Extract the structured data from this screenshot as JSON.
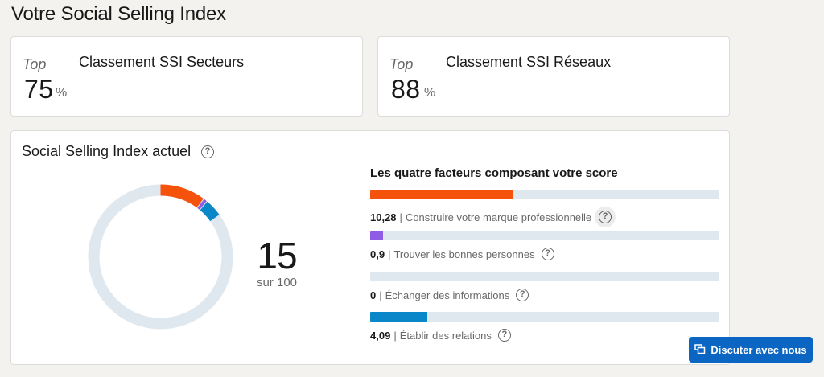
{
  "page_title": "Votre Social Selling Index",
  "rank_cards": [
    {
      "top_label": "Top",
      "title": "Classement SSI Secteurs",
      "value": "75",
      "unit": "%"
    },
    {
      "top_label": "Top",
      "title": "Classement SSI Réseaux",
      "value": "88",
      "unit": "%"
    }
  ],
  "ssi": {
    "title": "Social Selling Index actuel",
    "score": "15",
    "score_max": "sur 100",
    "score_value": 15.27,
    "score_total": 100,
    "factors_title": "Les quatre facteurs composant votre score",
    "factors": [
      {
        "value": "10,28",
        "label": "Construire votre marque professionnelle",
        "amount": 10.28,
        "max": 25,
        "color": "#f5520c"
      },
      {
        "value": "0,9",
        "label": "Trouver les bonnes personnes",
        "amount": 0.9,
        "max": 25,
        "color": "#8f5ce6"
      },
      {
        "value": "0",
        "label": "Échanger des informations",
        "amount": 0,
        "max": 25,
        "color": "#0a66c2"
      },
      {
        "value": "4,09",
        "label": "Établir des relations",
        "amount": 4.09,
        "max": 25,
        "color": "#0a87c8"
      }
    ],
    "donut_track_color": "#dfe8ef"
  },
  "chat_button": {
    "label": "Discuter avec nous",
    "icon": "chat-icon",
    "color": "#0a66c2"
  }
}
